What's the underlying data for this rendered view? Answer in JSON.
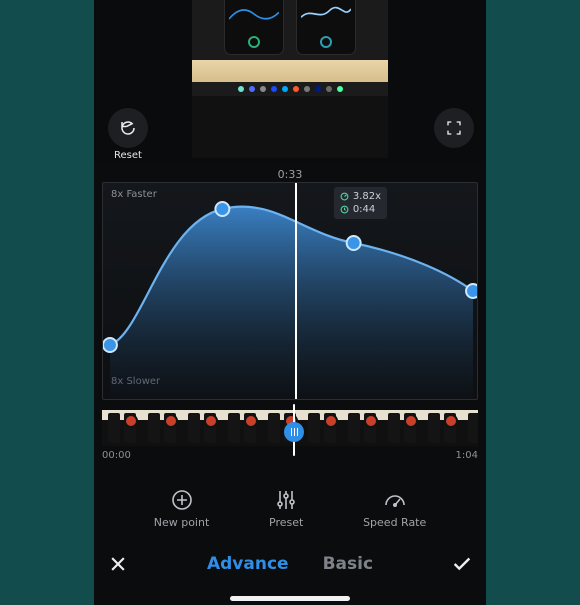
{
  "preview": {
    "reset_label": "Reset"
  },
  "timeline": {
    "playhead_time": "0:33",
    "start_time": "00:00",
    "end_time": "1:04"
  },
  "curve": {
    "label_fast": "8x Faster",
    "label_slow": "8x Slower",
    "info_speed": "3.82x",
    "info_duration": "0:44",
    "points": [
      {
        "x": 0.02,
        "y": 0.75
      },
      {
        "x": 0.32,
        "y": 0.12
      },
      {
        "x": 0.67,
        "y": 0.28
      },
      {
        "x": 0.99,
        "y": 0.5
      }
    ]
  },
  "tools": {
    "new_point": "New point",
    "preset": "Preset",
    "speed_rate": "Speed Rate"
  },
  "tabs": {
    "advance": "Advance",
    "basic": "Basic"
  },
  "colors": {
    "accent": "#2f8fe6",
    "curve_fill": "#2a6ca8"
  }
}
